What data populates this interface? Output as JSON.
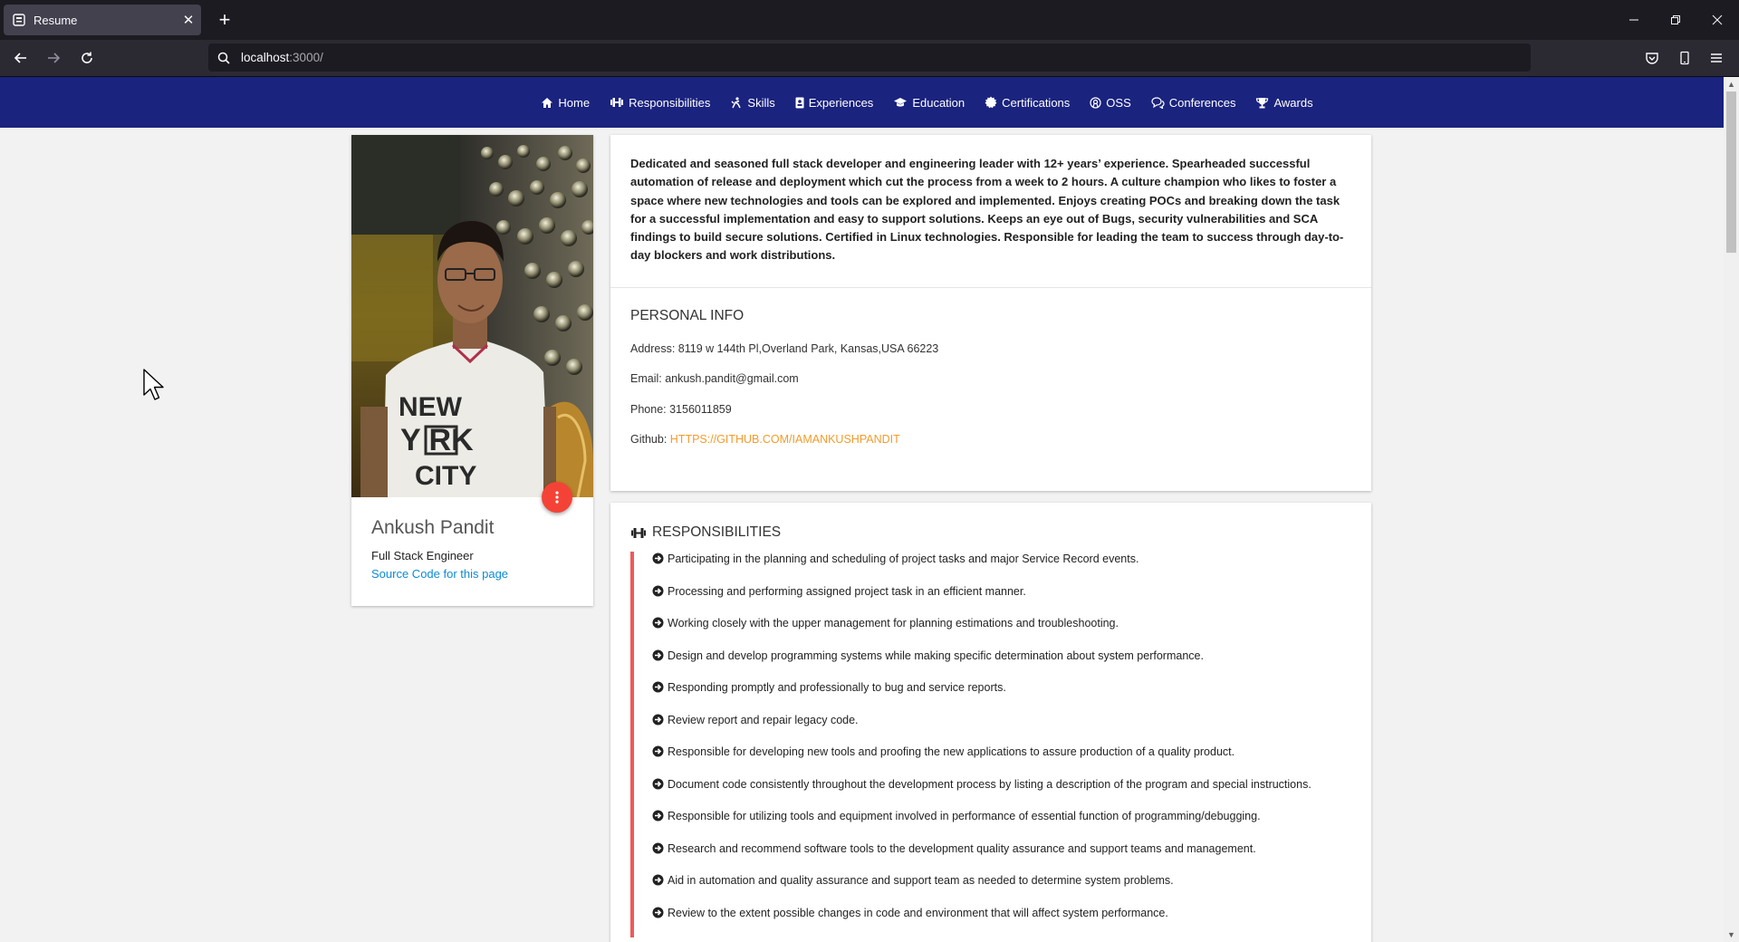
{
  "browser": {
    "tab_title": "Resume",
    "url_host": "localhost",
    "url_port": ":3000/",
    "new_tab_label": "+"
  },
  "nav": {
    "items": [
      {
        "label": "Home",
        "icon": "home-icon"
      },
      {
        "label": "Responsibilities",
        "icon": "dumbbell-icon"
      },
      {
        "label": "Skills",
        "icon": "skills-icon"
      },
      {
        "label": "Experiences",
        "icon": "id-badge-icon"
      },
      {
        "label": "Education",
        "icon": "graduation-cap-icon"
      },
      {
        "label": "Certifications",
        "icon": "certificate-icon"
      },
      {
        "label": "OSS",
        "icon": "oss-icon"
      },
      {
        "label": "Conferences",
        "icon": "comments-icon"
      },
      {
        "label": "Awards",
        "icon": "trophy-icon"
      }
    ],
    "background": "#1a237e"
  },
  "profile": {
    "name": "Ankush Pandit",
    "role": "Full Stack Engineer",
    "source_link": "Source Code for this page",
    "fab_color": "#f44336"
  },
  "about": {
    "summary": "Dedicated and seasoned full stack developer and engineering leader with 12+ years’ experience. Spearheaded successful automation of release and deployment which cut the process from a week to 2 hours. A culture champion who likes to foster a space where new technologies and tools can be explored and implemented. Enjoys creating POCs and breaking down the task for a successful implementation and easy to support solutions. Keeps an eye out of Bugs, security vulnerabilities and SCA findings to build secure solutions. Certified in Linux technologies. Responsible for leading the team to success through day-to-day blockers and work distributions.",
    "personal_info_title": "PERSONAL INFO",
    "address": "Address: 8119 w 144th Pl,Overland Park, Kansas,USA 66223",
    "email": "Email: ankush.pandit@gmail.com",
    "phone": "Phone: 3156011859",
    "github_label": "Github: ",
    "github_link": "HTTPS://GITHUB.COM/IAMANKUSHPANDIT"
  },
  "responsibilities": {
    "title": "RESPONSIBILITIES",
    "items": [
      "Participating in the planning and scheduling of project tasks and major Service Record events.",
      "Processing and performing assigned project task in an efficient manner.",
      "Working closely with the upper management for planning estimations and troubleshooting.",
      "Design and develop programming systems while making specific determination about system performance.",
      "Responding promptly and professionally to bug and service reports.",
      "Review report and repair legacy code.",
      "Responsible for developing new tools and proofing the new applications to assure production of a quality product.",
      "Document code consistently throughout the development process by listing a description of the program and special instructions.",
      "Responsible for utilizing tools and equipment involved in performance of essential function of programming/debugging.",
      "Research and recommend software tools to the development quality assurance and support teams and management.",
      "Aid in automation and quality assurance and support team as needed to determine system problems.",
      "Review to the extent possible changes in code and environment that will affect system performance."
    ],
    "accent": "#ef5a5a"
  }
}
